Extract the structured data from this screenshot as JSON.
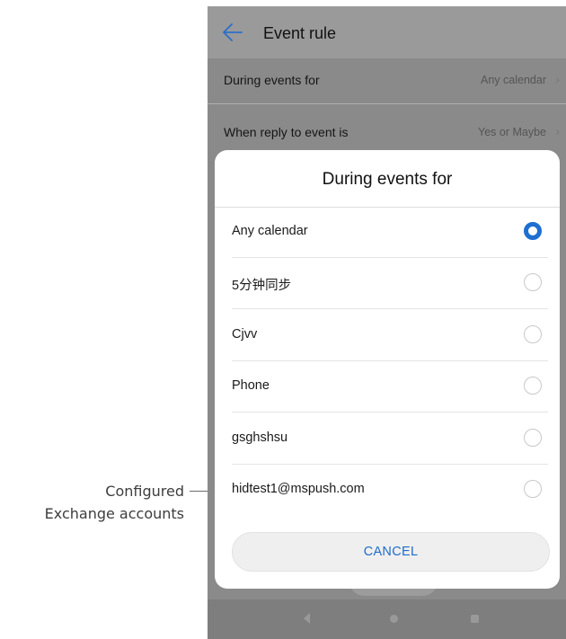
{
  "annotation": {
    "line1": "Configured",
    "line2": "Exchange accounts"
  },
  "header": {
    "title": "Event rule",
    "back_icon": "arrow-left-icon"
  },
  "settings": [
    {
      "label": "During events for",
      "value": "Any calendar"
    },
    {
      "label": "When reply to event is",
      "value": "Yes or Maybe"
    }
  ],
  "dialog": {
    "title": "During events for",
    "options": [
      {
        "label": "Any calendar",
        "selected": true
      },
      {
        "label": "5分钟同步",
        "selected": false
      },
      {
        "label": "Cjvv",
        "selected": false
      },
      {
        "label": "Phone",
        "selected": false
      },
      {
        "label": "gsghshsu",
        "selected": false
      },
      {
        "label": "hidtest1@mspush.com",
        "selected": false
      }
    ],
    "cancel_label": "CANCEL"
  },
  "colors": {
    "accent": "#1e6fd0",
    "scrim": "#8a8a8a"
  }
}
